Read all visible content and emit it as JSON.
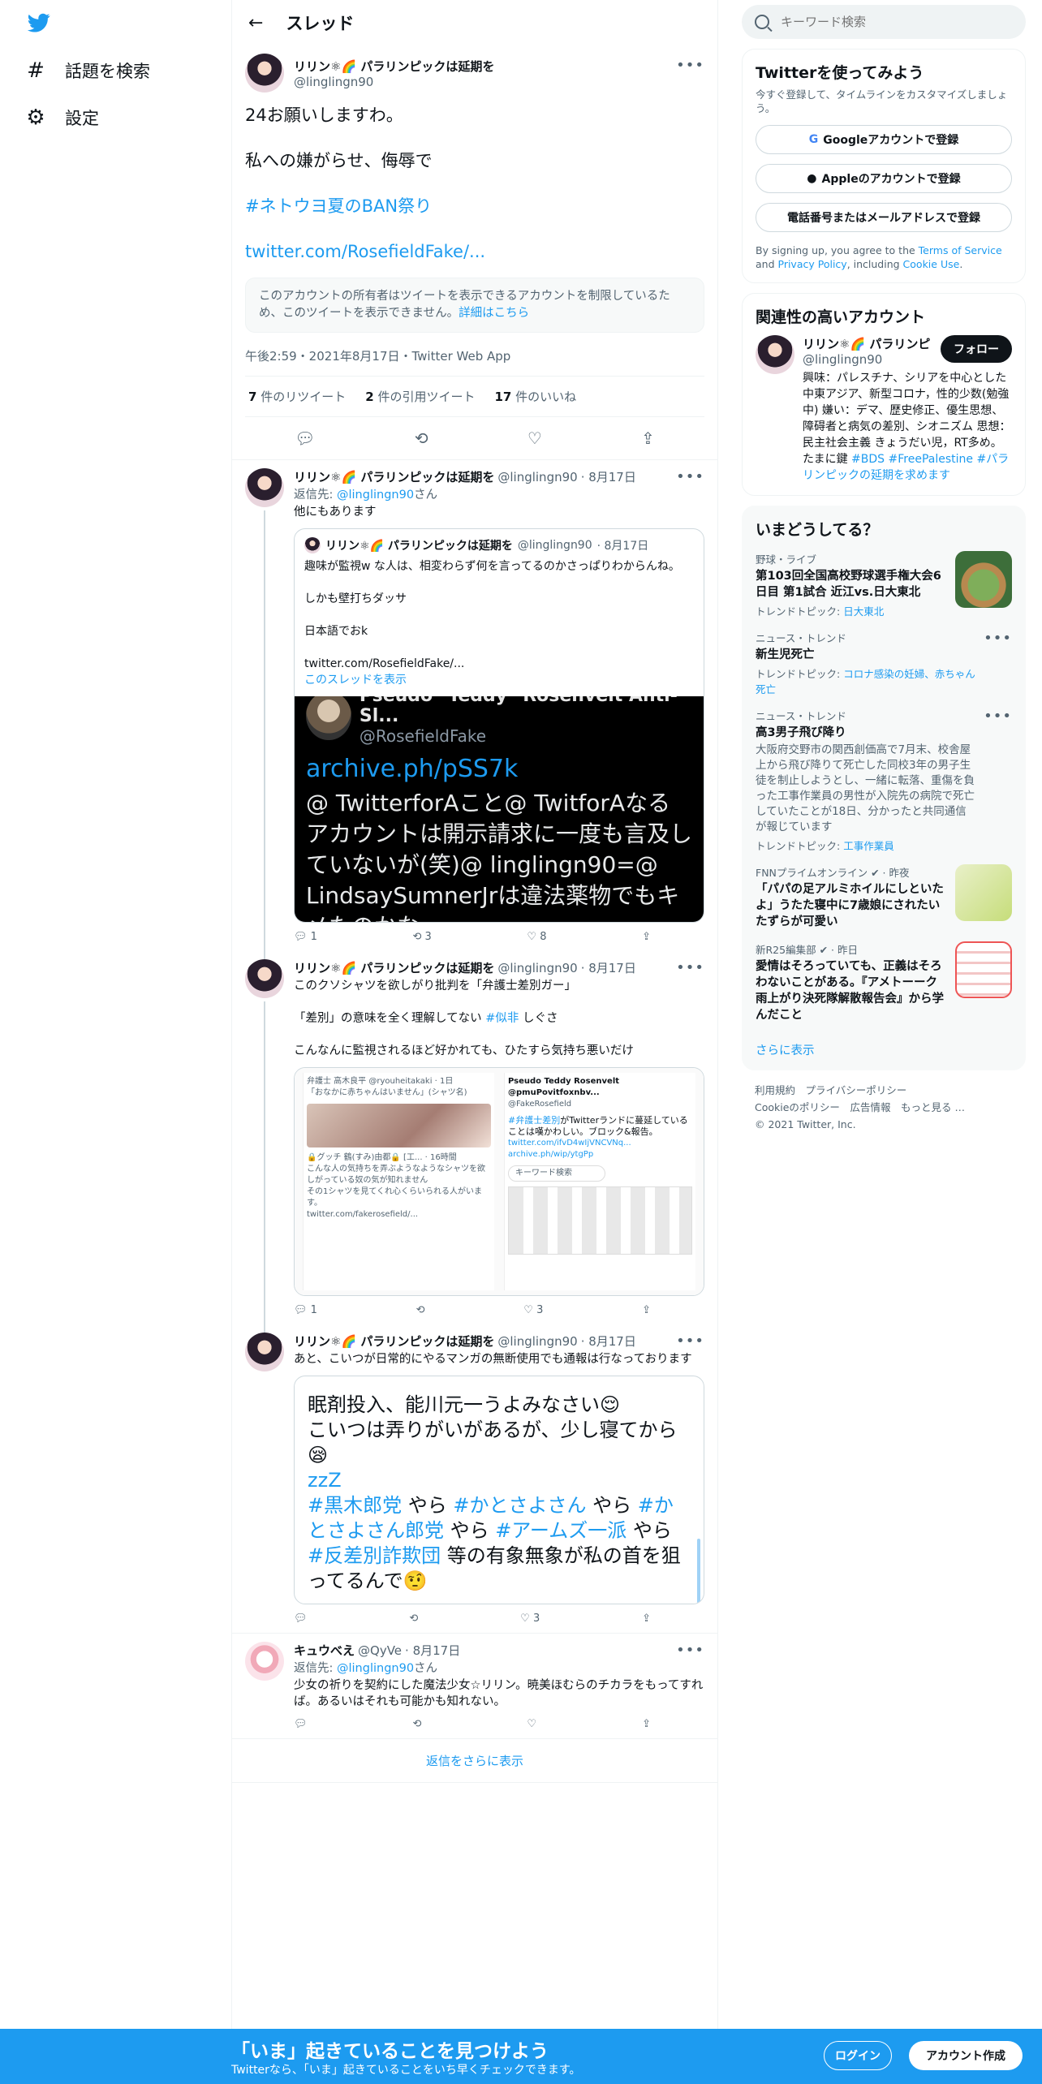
{
  "nav": {
    "explore_label": "話題を検索",
    "settings_label": "設定"
  },
  "header": {
    "title": "スレッド"
  },
  "focus": {
    "name": "リリン⚛🌈 パラリンピックは延期を",
    "handle": "@linglingn90",
    "lines": [
      "24お願いしますわ。",
      "私への嫌がらせ、侮辱で",
      "#ネトウヨ夏のBAN祭り",
      "twitter.com/RosefieldFake/..."
    ],
    "notice": "このアカウントの所有者はツイートを表示できるアカウントを制限しているため、このツイートを表示できません。",
    "notice_link": "詳細はこちら",
    "meta": "午後2:59・2021年8月17日・Twitter Web App",
    "retweets_n": "7",
    "retweets_label": "件のリツイート",
    "quotes_n": "2",
    "quotes_label": "件の引用ツイート",
    "likes_n": "17",
    "likes_label": "件のいいね"
  },
  "replies": [
    {
      "name": "リリン⚛🌈 パラリンピックは延期を",
      "handle": "@linglingn90",
      "date": "· 8月17日",
      "reply_to_prefix": "返信先: ",
      "reply_to": "@linglingn90",
      "reply_to_suffix": "さん",
      "text": "他にもあります",
      "quote": {
        "name": "リリン⚛🌈 パラリンピックは延期を",
        "handle": "@linglingn90",
        "date": "· 8月17日",
        "text": "趣味が監視w な人は、相変わらず何を言ってるのかさっぱりわからんね。\n\nしかも壁打ちダッサ\n\n日本語でおk\n\ntwitter.com/RosefieldFake/...",
        "show_thread": "このスレッドを表示",
        "image_name": "Pseudo \"Teddy\" Rosenvelt Anti-Sl...",
        "image_handle": "@RosefieldFake",
        "image_link": "archive.ph/pSS7k",
        "image_text": "@ TwitterforAこと@ TwitforAなるアカウントは開示請求に一度も言及していないが(笑)@ linglingn90=@ LindsaySumnerJrは違法薬物でもキメたのかな"
      },
      "counts": {
        "reply": "1",
        "retweet": "3",
        "like": "8"
      }
    },
    {
      "name": "リリン⚛🌈 パラリンピックは延期を",
      "handle": "@linglingn90",
      "date": "· 8月17日",
      "text_a": "このクソシャツを欲しがり批判を「弁護士差別ガー」\n\n「差別」の意味を全く理解してない ",
      "hashtag": "#似非",
      "text_b": " しぐさ\n\nこんなんに監視されるほど好かれても、ひたすら気持ち悪いだけ",
      "shot": {
        "left_title": "弁護士 高木良平 @ryouheitakaki · 1日",
        "left_text": "「おなかに赤ちゃんはいません」(シャツ名)",
        "left_reply": "🔒グッチ 鶴(すみ)由都🔒 [工... · 16時間",
        "left_reply_text": "こんな人の気持ちを弄ぶようなようなシャツを欲しがっている奴の気が知れません\nその1シャツを見てくれ心くらいられる人がいます。",
        "left_link": "twitter.com/fakerosefield/...",
        "right_title": "Pseudo Teddy Rosenvelt @pmuPovitfoxnbv...",
        "right_handle": "@FakeRosefield",
        "right_tag": "#弁護士差別",
        "right_text": "がTwitterランドに蔓延していることは嘆かわしい。ブロック&報告。",
        "right_link1": "twitter.com/ifvD4wIjVNCVNq...",
        "right_link2": "archive.ph/wip/ytgPp",
        "right_search": "キーワード検索"
      },
      "counts": {
        "reply": "1",
        "retweet": "",
        "like": "3"
      }
    },
    {
      "name": "リリン⚛🌈 パラリンピックは延期を",
      "handle": "@linglingn90",
      "date": "· 8月17日",
      "text": "あと、こいつが日常的にやるマンガの無断使用でも通報は行なっております",
      "big": {
        "line1": "眠剤投入、能川元一うよみなさい😌",
        "line2": "こいつは弄りがいがあるが、少し寝てから😪",
        "line3": "zzZ",
        "tag1": "#黒木郎党",
        "mid1": " やら ",
        "tag2": "#かとさよさん",
        "mid2": " やら ",
        "tag3": "#かとさよさん郎党",
        "mid3": " やら ",
        "tag4": "#アームズ一派",
        "mid4": " やら ",
        "tag5": "#反差別詐欺団",
        "end": " 等の有象無象が私の首を狙ってるんで🤨"
      },
      "counts": {
        "reply": "",
        "retweet": "",
        "like": "3"
      }
    },
    {
      "name": "キュウべえ",
      "handle": "@QyVe",
      "date": "· 8月17日",
      "reply_to_prefix": "返信先: ",
      "reply_to": "@linglingn90",
      "reply_to_suffix": "さん",
      "text": "少女の祈りを契約にした魔法少女☆リリン。暁美ほむらのチカラをもってすれば。あるいはそれも可能かも知れない。",
      "counts": {
        "reply": "",
        "retweet": "",
        "like": ""
      }
    }
  ],
  "more_replies": "返信をさらに表示",
  "search": {
    "placeholder": "キーワード検索"
  },
  "signup": {
    "title": "Twitterを使ってみよう",
    "sub": "今すぐ登録して、タイムラインをカスタマイズしましょう。",
    "google": "Googleアカウントで登録",
    "apple": "Appleのアカウントで登録",
    "phone": "電話番号またはメールアドレスで登録",
    "legal_a": "By signing up, you agree to the ",
    "terms": "Terms of Service",
    "legal_b": " and ",
    "privacy": "Privacy Policy",
    "legal_c": ", including ",
    "cookie": "Cookie Use",
    "legal_d": "."
  },
  "related": {
    "title": "関連性の高いアカウント",
    "name": "リリン⚛🌈 パラリンピ",
    "handle": "@linglingn90",
    "follow": "フォロー",
    "bio_a": "興味：パレスチナ、シリアを中心とした中東アジア、新型コロナ，性的少数(勉強中) 嫌い：デマ、歴史修正、優生思想、障碍者と病気の差別、シオニズム 思想：民主社会主義 きょうだい児，RT多め。たまに鍵 ",
    "bio_tag1": "#BDS",
    "bio_tag2": "#FreePalestine",
    "bio_tag3": "#パラリンピックの延期を求めます"
  },
  "trends": {
    "title": "いまどうしてる？",
    "items": [
      {
        "meta": "野球・ライブ",
        "title": "第103回全国高校野球選手権大会6日目 第1試合 近江vs.日大東北",
        "sub_label": "トレンドトピック: ",
        "sub_link": "日大東北"
      },
      {
        "meta": "ニュース・トレンド",
        "title": "新生児死亡",
        "sub_label": "トレンドトピック: ",
        "sub_link": "コロナ感染の妊婦、赤ちゃん死亡"
      },
      {
        "meta": "ニュース・トレンド",
        "title": "高3男子飛び降り",
        "desc": "大阪府交野市の関西創価高で7月末、校舎屋上から飛び降りて死亡した同校3年の男子生徒を制止しようとし、一緒に転落、重傷を負った工事作業員の男性が入院先の病院で死亡していたことが18日、分かったと共同通信が報じています",
        "sub_label": "トレンドトピック: ",
        "sub_link": "工事作業員"
      },
      {
        "meta": "FNNプライムオンライン ✔ · 昨夜",
        "title": "「パパの足アルミホイルにしといたよ」うたた寝中に7歳娘にされたいたずらが可愛い"
      },
      {
        "meta": "新R25編集部 ✔ · 昨日",
        "title": "愛情はそろっていても、正義はそろわないことがある。『アメトーーク 雨上がり決死隊解散報告会』から学んだこと"
      }
    ],
    "show_more": "さらに表示"
  },
  "footer": {
    "tos": "利用規約",
    "privacy": "プライバシーポリシー",
    "cookie": "Cookieのポリシー",
    "ads": "広告情報",
    "more": "もっと見る …",
    "copyright": "© 2021 Twitter, Inc."
  },
  "banner": {
    "title": "「いま」起きていることを見つけよう",
    "sub": "Twitterなら、「いま」起きていることをいち早くチェックできます。",
    "login": "ログイン",
    "signup": "アカウント作成"
  }
}
